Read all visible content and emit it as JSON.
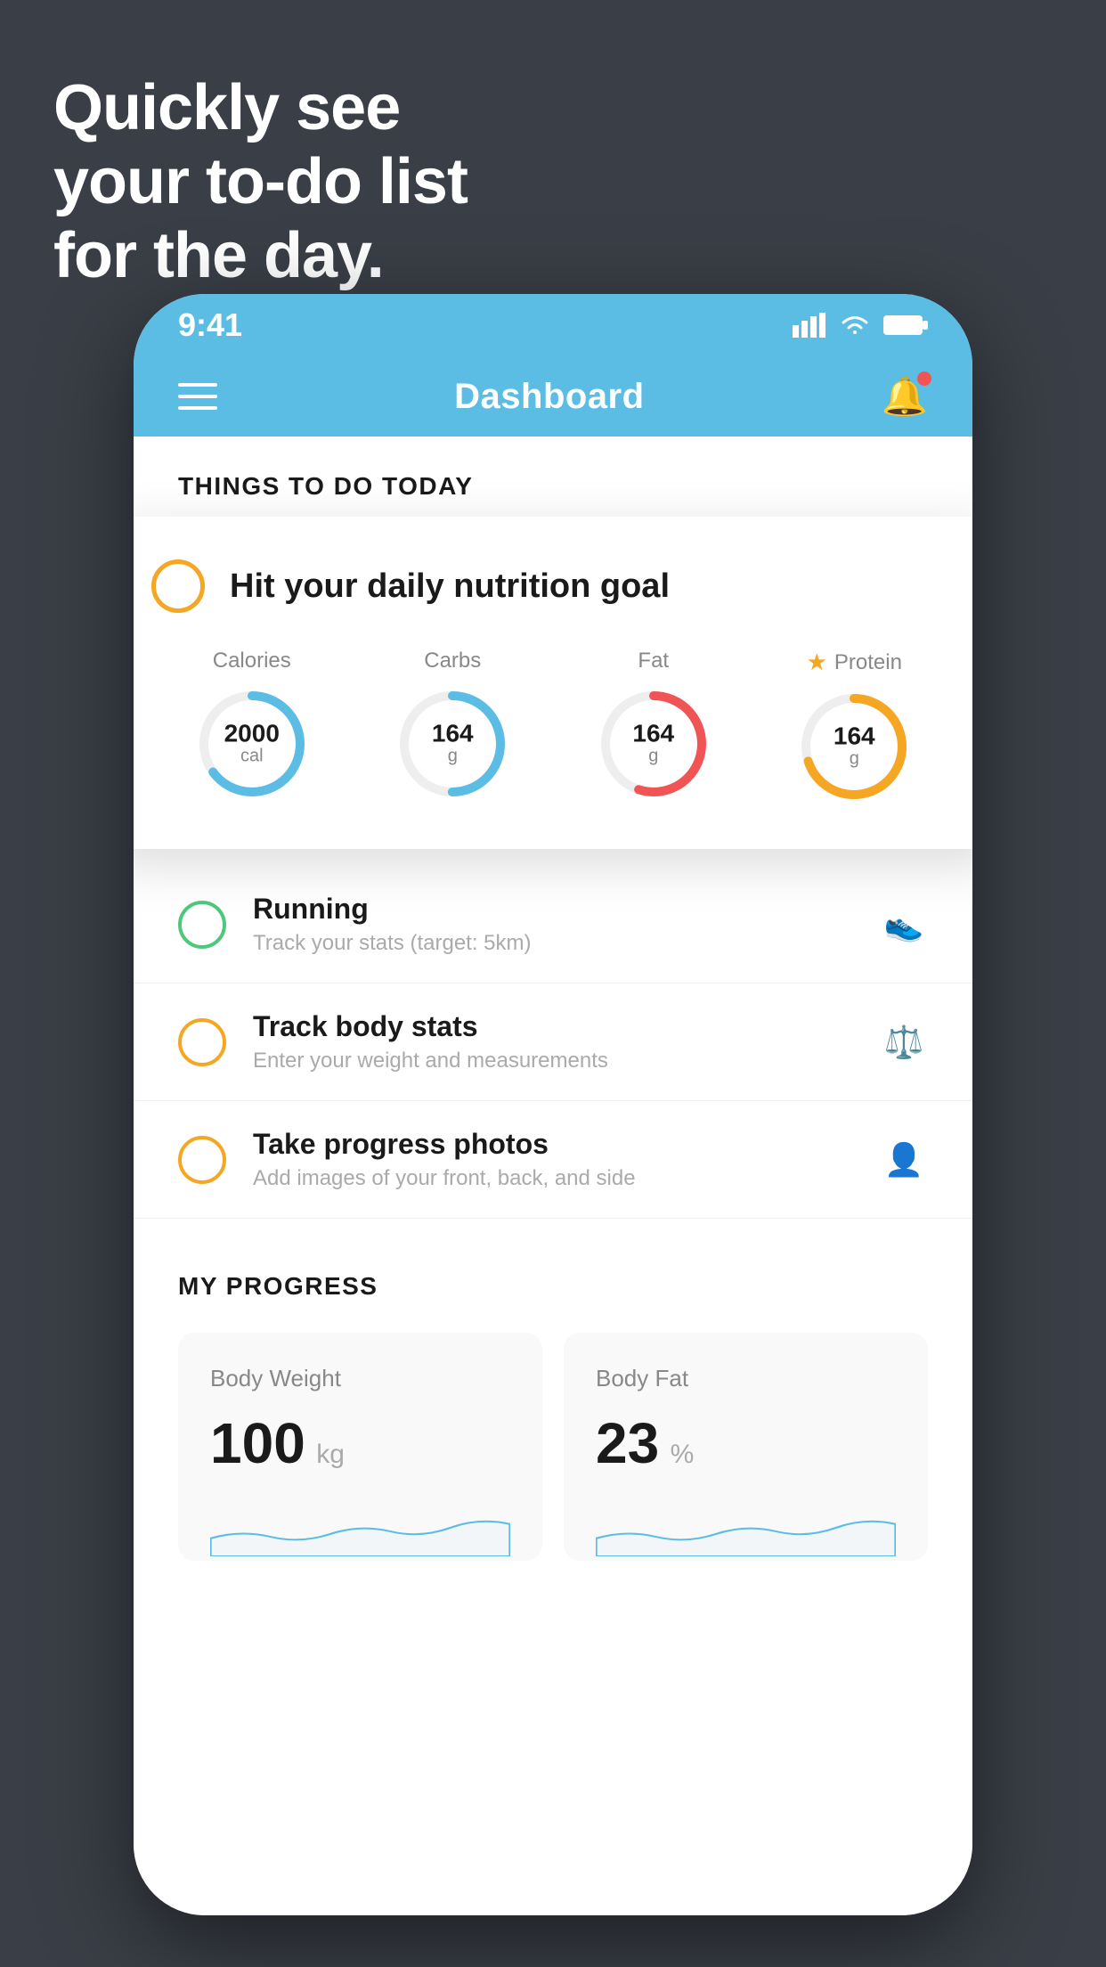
{
  "hero": {
    "line1": "Quickly see",
    "line2": "your to-do list",
    "line3": "for the day."
  },
  "status_bar": {
    "time": "9:41"
  },
  "nav": {
    "title": "Dashboard"
  },
  "things_section": {
    "label": "THINGS TO DO TODAY"
  },
  "nutrition_card": {
    "title": "Hit your daily nutrition goal",
    "items": [
      {
        "label": "Calories",
        "value": "2000",
        "unit": "cal",
        "color": "#5bbde4",
        "stroke_pct": 65
      },
      {
        "label": "Carbs",
        "value": "164",
        "unit": "g",
        "color": "#5bbde4",
        "stroke_pct": 50
      },
      {
        "label": "Fat",
        "value": "164",
        "unit": "g",
        "color": "#f05454",
        "stroke_pct": 55
      },
      {
        "label": "Protein",
        "value": "164",
        "unit": "g",
        "color": "#f5a623",
        "stroke_pct": 70,
        "star": true
      }
    ]
  },
  "todo_items": [
    {
      "circle_color": "green",
      "title": "Running",
      "subtitle": "Track your stats (target: 5km)",
      "icon": "shoe"
    },
    {
      "circle_color": "yellow",
      "title": "Track body stats",
      "subtitle": "Enter your weight and measurements",
      "icon": "scale"
    },
    {
      "circle_color": "yellow",
      "title": "Take progress photos",
      "subtitle": "Add images of your front, back, and side",
      "icon": "person"
    }
  ],
  "progress": {
    "header": "MY PROGRESS",
    "cards": [
      {
        "title": "Body Weight",
        "number": "100",
        "unit": "kg"
      },
      {
        "title": "Body Fat",
        "number": "23",
        "unit": "%"
      }
    ]
  }
}
